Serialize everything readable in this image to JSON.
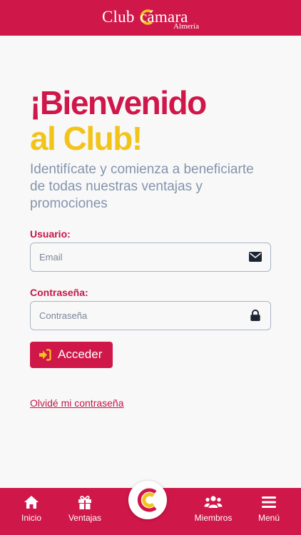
{
  "header": {
    "brand_club": "Club",
    "brand_camara": "cámara",
    "brand_sub": "Almería"
  },
  "welcome": {
    "line1": "¡Bienvenido",
    "line2": "al Club!",
    "subtitle": "Identifícate y comienza a beneficiarte de todas nuestras ventajas y promociones"
  },
  "form": {
    "user_label": "Usuario:",
    "user_placeholder": "Email",
    "user_icon": "envelope-icon",
    "pass_label": "Contraseña:",
    "pass_placeholder": "Contraseña",
    "pass_icon": "lock-icon",
    "submit_label": "Acceder",
    "submit_icon": "sign-in-icon",
    "forgot_link": "Olvidé mi contraseña"
  },
  "nav": {
    "items": [
      {
        "label": "Inicio",
        "icon": "home-icon"
      },
      {
        "label": "Ventajas",
        "icon": "gift-icon"
      },
      {
        "label": "Miembros",
        "icon": "users-icon"
      },
      {
        "label": "Menú",
        "icon": "hamburger-icon"
      }
    ],
    "center_icon": "club-camara-logo"
  },
  "colors": {
    "primary": "#d0174a",
    "accent_yellow": "#f2c41a",
    "subtitle_gray": "#8394ab",
    "background": "#f8f8f9"
  }
}
